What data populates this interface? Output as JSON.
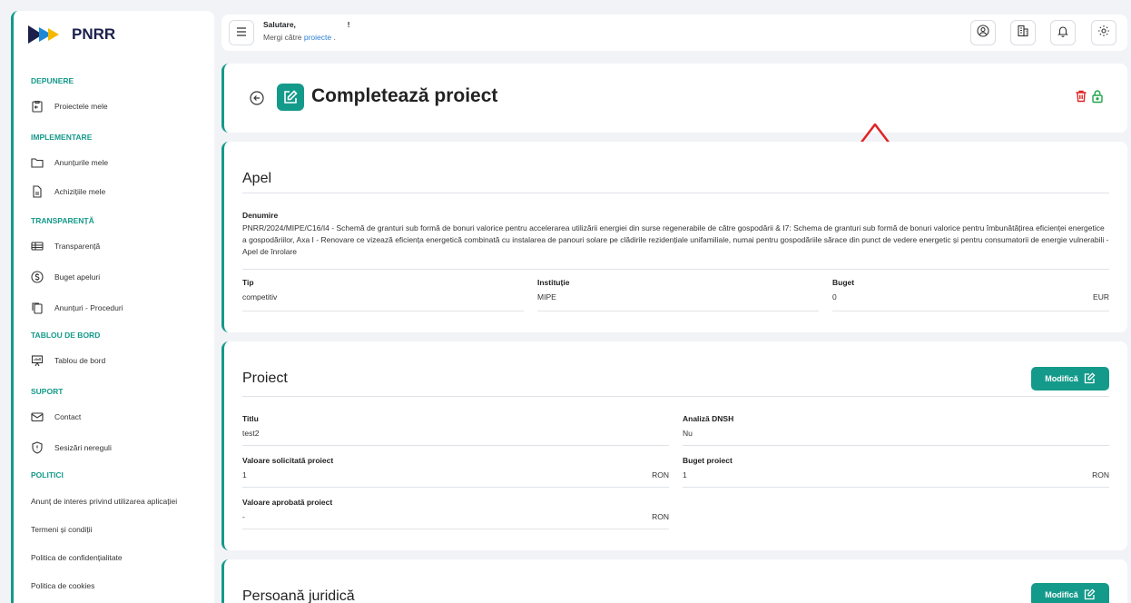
{
  "app": {
    "logo_text": "PNRR"
  },
  "sidebar": {
    "sections": [
      {
        "label": "DEPUNERE"
      },
      {
        "label": "IMPLEMENTARE"
      },
      {
        "label": "TRANSPARENȚĂ"
      },
      {
        "label": "TABLOU DE BORD"
      },
      {
        "label": "SUPORT"
      },
      {
        "label": "POLITICI"
      }
    ],
    "items": [
      {
        "label": "Proiectele mele",
        "icon": "folder-arrow-icon"
      },
      {
        "label": "Anunțurile mele",
        "icon": "folder-icon"
      },
      {
        "label": "Achizițiile mele",
        "icon": "document-icon"
      },
      {
        "label": "Transparență",
        "icon": "table-icon"
      },
      {
        "label": "Buget apeluri",
        "icon": "dollar-icon"
      },
      {
        "label": "Anunțuri - Proceduri",
        "icon": "copy-icon"
      },
      {
        "label": "Tablou de bord",
        "icon": "presentation-icon"
      },
      {
        "label": "Contact",
        "icon": "mail-icon"
      },
      {
        "label": "Sesizări nereguli",
        "icon": "shield-alert-icon"
      }
    ],
    "policies": [
      "Anunț de interes privind utilizarea aplicației",
      "Termeni și condiții",
      "Politica de confidențialitate",
      "Politica de cookies"
    ]
  },
  "header": {
    "greeting": "Salutare,                        !",
    "goto_prefix": "Mergi către ",
    "goto_link": "proiecte",
    "goto_suffix": " .",
    "icons": [
      "user-circle-icon",
      "building-icon",
      "bell-icon",
      "settings-icon"
    ]
  },
  "page": {
    "title": "Completează proiect"
  },
  "apel": {
    "title": "Apel",
    "denumire_label": "Denumire",
    "denumire_value": "PNRR/2024/MIPE/C16/I4 - Schemă de granturi sub formă de bonuri valorice pentru accelerarea utilizării energiei din surse regenerabile de către gospodării & I7: Schema de granturi sub formă de bonuri valorice pentru îmbunătățirea eficienței energetice a gospodăriilor, Axa I - Renovare ce vizează eficiența energetică combinată cu instalarea de panouri solare pe clădirile rezidențiale unifamiliale, numai pentru gospodăriile sărace din punct de vedere energetic și pentru consumatorii de energie vulnerabili - Apel de înrolare",
    "tip_label": "Tip",
    "tip_value": "competitiv",
    "institutie_label": "Instituție",
    "institutie_value": "MIPE",
    "buget_label": "Buget",
    "buget_value": "0",
    "buget_unit": "EUR"
  },
  "proiect": {
    "title": "Proiect",
    "modify_label": "Modifică",
    "titlu_label": "Titlu",
    "titlu_value": "test2",
    "dnsh_label": "Analiză DNSH",
    "dnsh_value": "Nu",
    "val_solicitata_label": "Valoare solicitată proiect",
    "val_solicitata_value": "1",
    "val_solicitata_unit": "RON",
    "buget_label": "Buget proiect",
    "buget_value": "1",
    "buget_unit": "RON",
    "val_aprobata_label": "Valoare aprobată proiect",
    "val_aprobata_value": "-",
    "val_aprobata_unit": "RON"
  },
  "persoana": {
    "title": "Persoană juridică",
    "modify_label": "Modifică"
  },
  "colors": {
    "accent": "#149a8a",
    "danger": "#e02424",
    "success": "#1fa34a",
    "link": "#2a7fd4"
  }
}
